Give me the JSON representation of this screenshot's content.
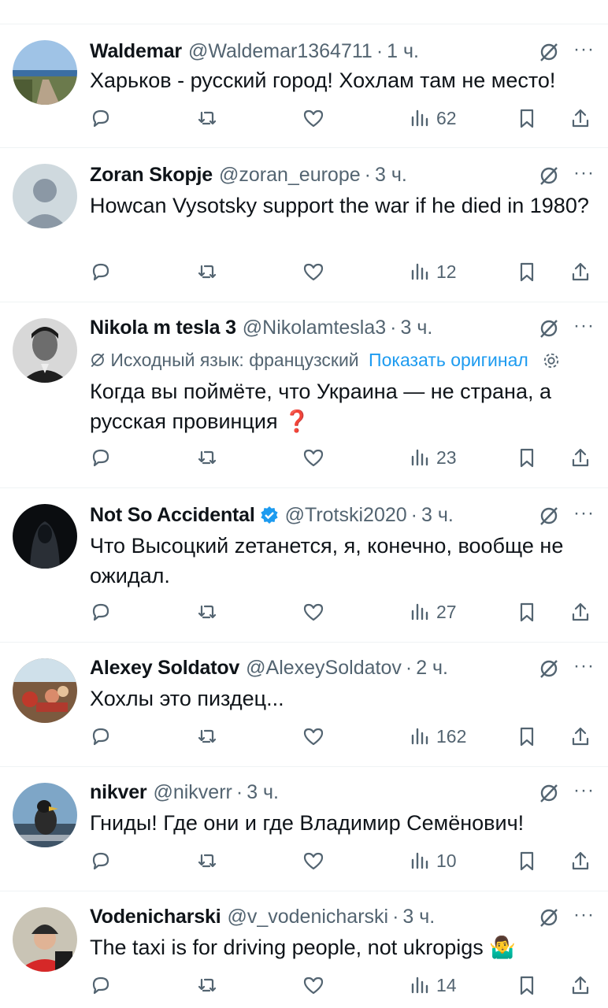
{
  "tweets": [
    {
      "name": "Waldemar",
      "handle": "@Waldemar1364711",
      "dot": "·",
      "time": "1 ч.",
      "body": "Харьков - русский город! Хохлам там не место!",
      "views": "62",
      "avatar": "avatar-seaside-path"
    },
    {
      "name": "Zoran Skopje",
      "handle": "@zoran_europe",
      "dot": "·",
      "time": "3 ч.",
      "body": "Howcan Vysotsky support the war if he died in 1980?",
      "views": "12",
      "avatar": "avatar-default"
    },
    {
      "name": "Nikola m tesla 3",
      "handle": "@Nikolamtesla3",
      "dot": "·",
      "time": "3 ч.",
      "translation_note": "Исходный язык: французский",
      "show_original": "Показать оригинал",
      "body": "Когда вы поймёте, что Украина — не страна, а русская провинция ❓",
      "views": "23",
      "avatar": "avatar-portrait"
    },
    {
      "name": "Not So Accidental",
      "handle": "@Trotski2020",
      "dot": "·",
      "time": "3 ч.",
      "verified": true,
      "body": "Что Высоцкий zетанется, я, конечно, вообще не ожидал.",
      "views": "27",
      "avatar": "avatar-dark-figure"
    },
    {
      "name": "Alexey Soldatov",
      "handle": "@AlexeySoldatov",
      "dot": "·",
      "time": "2 ч.",
      "body": "Хохлы это пиздец...",
      "views": "162",
      "avatar": "avatar-crowd"
    },
    {
      "name": "nikver",
      "handle": "@nikverr",
      "dot": "·",
      "time": "3 ч.",
      "body": "Гниды! Где они и где Владимир Семёнович!",
      "views": "10",
      "avatar": "avatar-duck"
    },
    {
      "name": "Vodenicharski",
      "handle": "@v_vodenicharski",
      "dot": "·",
      "time": "3 ч.",
      "body": "The taxi is for driving people, not ukropigs 🤷‍♂️",
      "views": "14",
      "avatar": "avatar-red-cap"
    }
  ],
  "icons": {
    "more": "···",
    "grok": "grok-icon",
    "reply": "reply-icon",
    "retweet": "retweet-icon",
    "like": "like-icon",
    "views": "views-icon",
    "bookmark": "bookmark-icon",
    "share": "share-icon"
  },
  "colors": {
    "text": "#0f1419",
    "muted": "#536471",
    "link": "#1d9bf0",
    "divider": "#eff3f4"
  }
}
